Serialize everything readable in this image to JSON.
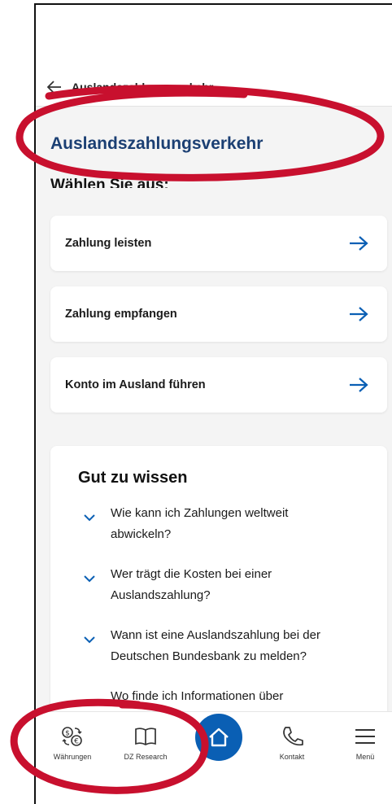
{
  "header": {
    "back_label": "Zurück",
    "title": "Auslandszahlungsverkehr"
  },
  "main": {
    "page_title": "Auslandszahlungsverkehr",
    "subtitle": "Wählen Sie aus:",
    "options": [
      {
        "label": "Zahlung leisten"
      },
      {
        "label": "Zahlung empfangen"
      },
      {
        "label": "Konto im Ausland führen"
      }
    ],
    "info": {
      "title": "Gut zu wissen",
      "faqs": [
        {
          "line1": "Wie kann ich Zahlungen weltweit",
          "line2": "abwickeln?"
        },
        {
          "line1": "Wer trägt die Kosten bei einer",
          "line2": "Auslandszahlung?"
        },
        {
          "line1": "Wann ist eine Auslandszahlung bei der",
          "line2": "Deutschen Bundesbank zu melden?"
        },
        {
          "line1": "Wo finde ich Informationen über",
          "line2": ""
        }
      ]
    }
  },
  "bottom_nav": {
    "items": [
      {
        "label": "Währungen",
        "icon": "currency-exchange-icon"
      },
      {
        "label": "DZ Research",
        "icon": "book-icon"
      },
      {
        "label": "",
        "icon": "home-icon"
      },
      {
        "label": "Kontakt",
        "icon": "phone-icon"
      },
      {
        "label": "Menü",
        "icon": "menu-icon"
      }
    ]
  },
  "colors": {
    "accent": "#0a5fb4",
    "title": "#1b3f73",
    "annotation": "#c8102e",
    "background": "#f4f4f4"
  }
}
